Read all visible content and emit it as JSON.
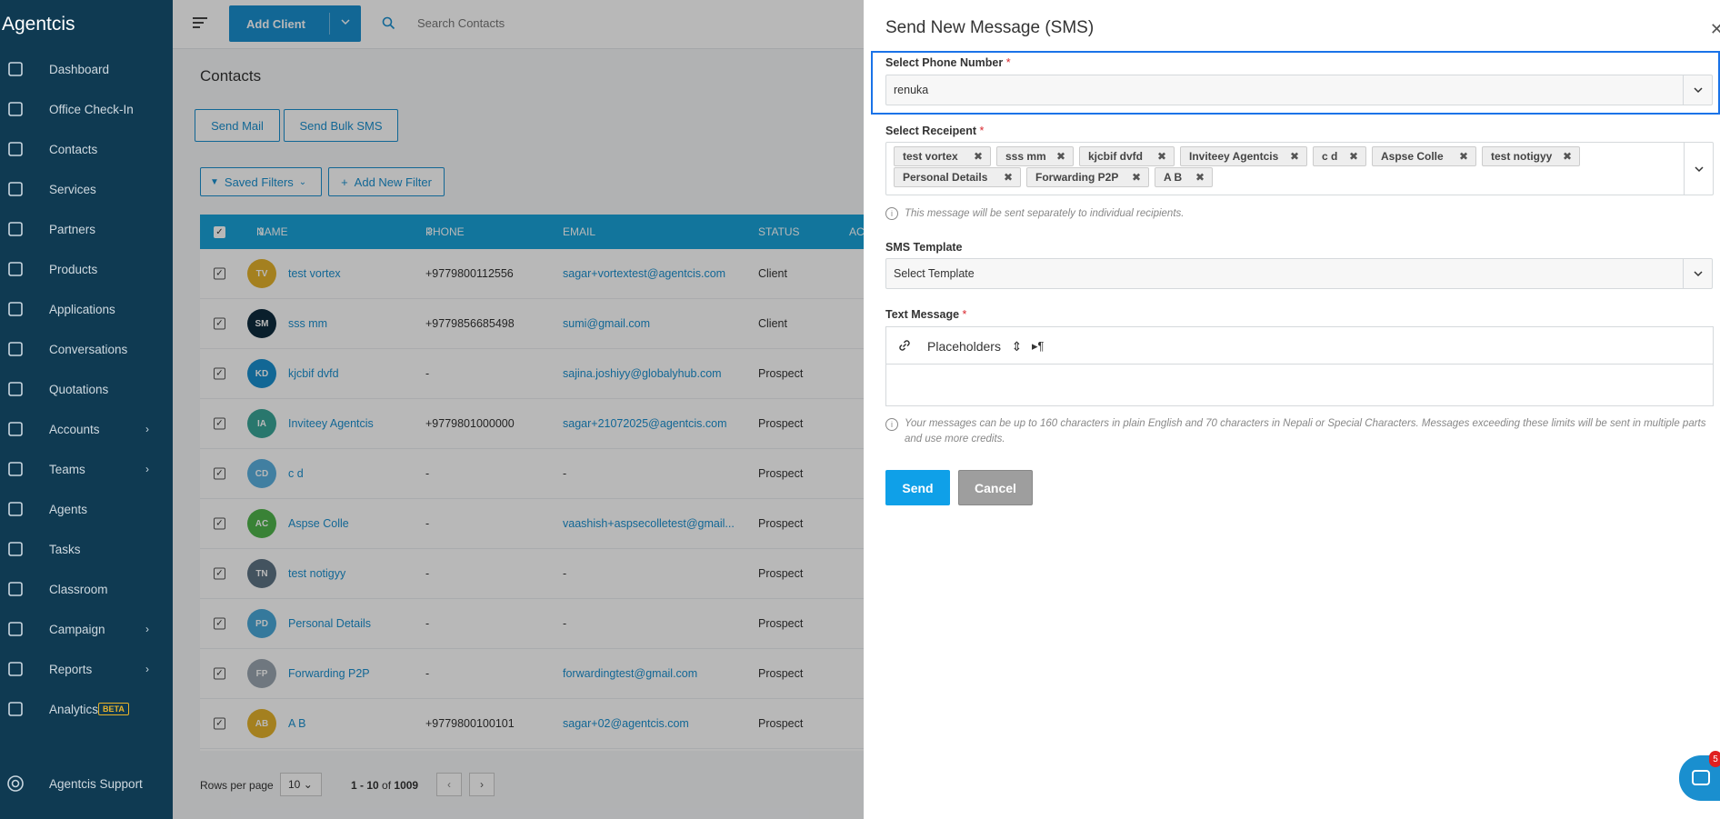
{
  "app": {
    "brand": "Agentcis"
  },
  "sidebar": {
    "items": [
      {
        "label": "Dashboard",
        "icon": "speedometer-icon"
      },
      {
        "label": "Office Check-In",
        "icon": "checkin-icon"
      },
      {
        "label": "Contacts",
        "icon": "contacts-icon"
      },
      {
        "label": "Services",
        "icon": "services-icon"
      },
      {
        "label": "Partners",
        "icon": "partners-icon"
      },
      {
        "label": "Products",
        "icon": "products-icon"
      },
      {
        "label": "Applications",
        "icon": "applications-icon"
      },
      {
        "label": "Conversations",
        "icon": "conversations-icon"
      },
      {
        "label": "Quotations",
        "icon": "quotations-icon"
      },
      {
        "label": "Accounts",
        "icon": "accounts-icon",
        "chevron": true
      },
      {
        "label": "Teams",
        "icon": "teams-icon",
        "chevron": true
      },
      {
        "label": "Agents",
        "icon": "agents-icon"
      },
      {
        "label": "Tasks",
        "icon": "tasks-icon"
      },
      {
        "label": "Classroom",
        "icon": "classroom-icon"
      },
      {
        "label": "Campaign",
        "icon": "campaign-icon",
        "chevron": true
      },
      {
        "label": "Reports",
        "icon": "reports-icon",
        "chevron": true
      },
      {
        "label": "Analytics",
        "icon": "analytics-icon",
        "badge": "BETA"
      }
    ],
    "support": "Agentcis Support"
  },
  "topbar": {
    "add_client": "Add Client",
    "search_placeholder": "Search Contacts"
  },
  "main": {
    "title": "Contacts",
    "send_mail": "Send Mail",
    "send_bulk_sms": "Send Bulk SMS",
    "saved_filters": "Saved Filters",
    "add_filter": "Add New Filter",
    "columns": {
      "name": "NAME",
      "phone": "PHONE",
      "email": "EMAIL",
      "status": "STATUS",
      "action": "AC"
    },
    "rows": [
      {
        "initials": "TV",
        "color": "#e3b22b",
        "name": "test vortex",
        "phone": "+9779800112556",
        "email": "sagar+vortextest@agentcis.com",
        "status": "Client"
      },
      {
        "initials": "SM",
        "color": "#0e2c3e",
        "name": "sss mm",
        "phone": "+9779856685498",
        "email": "sumi@gmail.com",
        "status": "Client"
      },
      {
        "initials": "KD",
        "color": "#1a8fcf",
        "name": "kjcbif dvfd",
        "phone": "-",
        "email": "sajina.joshiyy@globalyhub.com",
        "status": "Prospect"
      },
      {
        "initials": "IA",
        "color": "#3aa597",
        "name": "Inviteey Agentcis",
        "phone": "+9779801000000",
        "email": "sagar+21072025@agentcis.com",
        "status": "Prospect"
      },
      {
        "initials": "CD",
        "color": "#5ab0e0",
        "name": "c d",
        "phone": "-",
        "email": "-",
        "status": "Prospect"
      },
      {
        "initials": "AC",
        "color": "#4fb44b",
        "name": "Aspse Colle",
        "phone": "-",
        "email": "vaashish+aspsecolletest@gmail...",
        "status": "Prospect"
      },
      {
        "initials": "TN",
        "color": "#5d7384",
        "name": "test notigyy",
        "phone": "-",
        "email": "-",
        "status": "Prospect"
      },
      {
        "initials": "PD",
        "color": "#4aa8d8",
        "name": "Personal Details",
        "phone": "-",
        "email": "-",
        "status": "Prospect"
      },
      {
        "initials": "FP",
        "color": "#9aa6b0",
        "name": "Forwarding P2P",
        "phone": "-",
        "email": "forwardingtest@gmail.com",
        "status": "Prospect"
      },
      {
        "initials": "AB",
        "color": "#e3b22b",
        "name": "A B",
        "phone": "+9779800100101",
        "email": "sagar+02@agentcis.com",
        "status": "Prospect"
      }
    ],
    "pagination": {
      "rows_per_page_label": "Rows per page",
      "rows_per_page": "10",
      "range": "1 - 10",
      "of_label": "of",
      "total": "1009"
    }
  },
  "modal": {
    "title": "Send New Message (SMS)",
    "phone_label": "Select Phone Number",
    "phone_value": "renuka",
    "recipient_label": "Select Receipent",
    "recipients": [
      "test vortex",
      "sss mm",
      "kjcbif dvfd",
      "Inviteey Agentcis",
      "c d",
      "Aspse Colle",
      "test notigyy",
      "Personal Details",
      "Forwarding P2P",
      "A B"
    ],
    "recipient_note": "This message will be sent separately to individual recipients.",
    "template_label": "SMS Template",
    "template_value": "Select Template",
    "text_label": "Text Message",
    "placeholders": "Placeholders",
    "text_note": "Your messages can be up to 160 characters in plain English and 70 characters in Nepali or Special Characters. Messages exceeding these limits will be sent in multiple parts and use more credits.",
    "send": "Send",
    "cancel": "Cancel"
  },
  "chat": {
    "badge": "5"
  }
}
